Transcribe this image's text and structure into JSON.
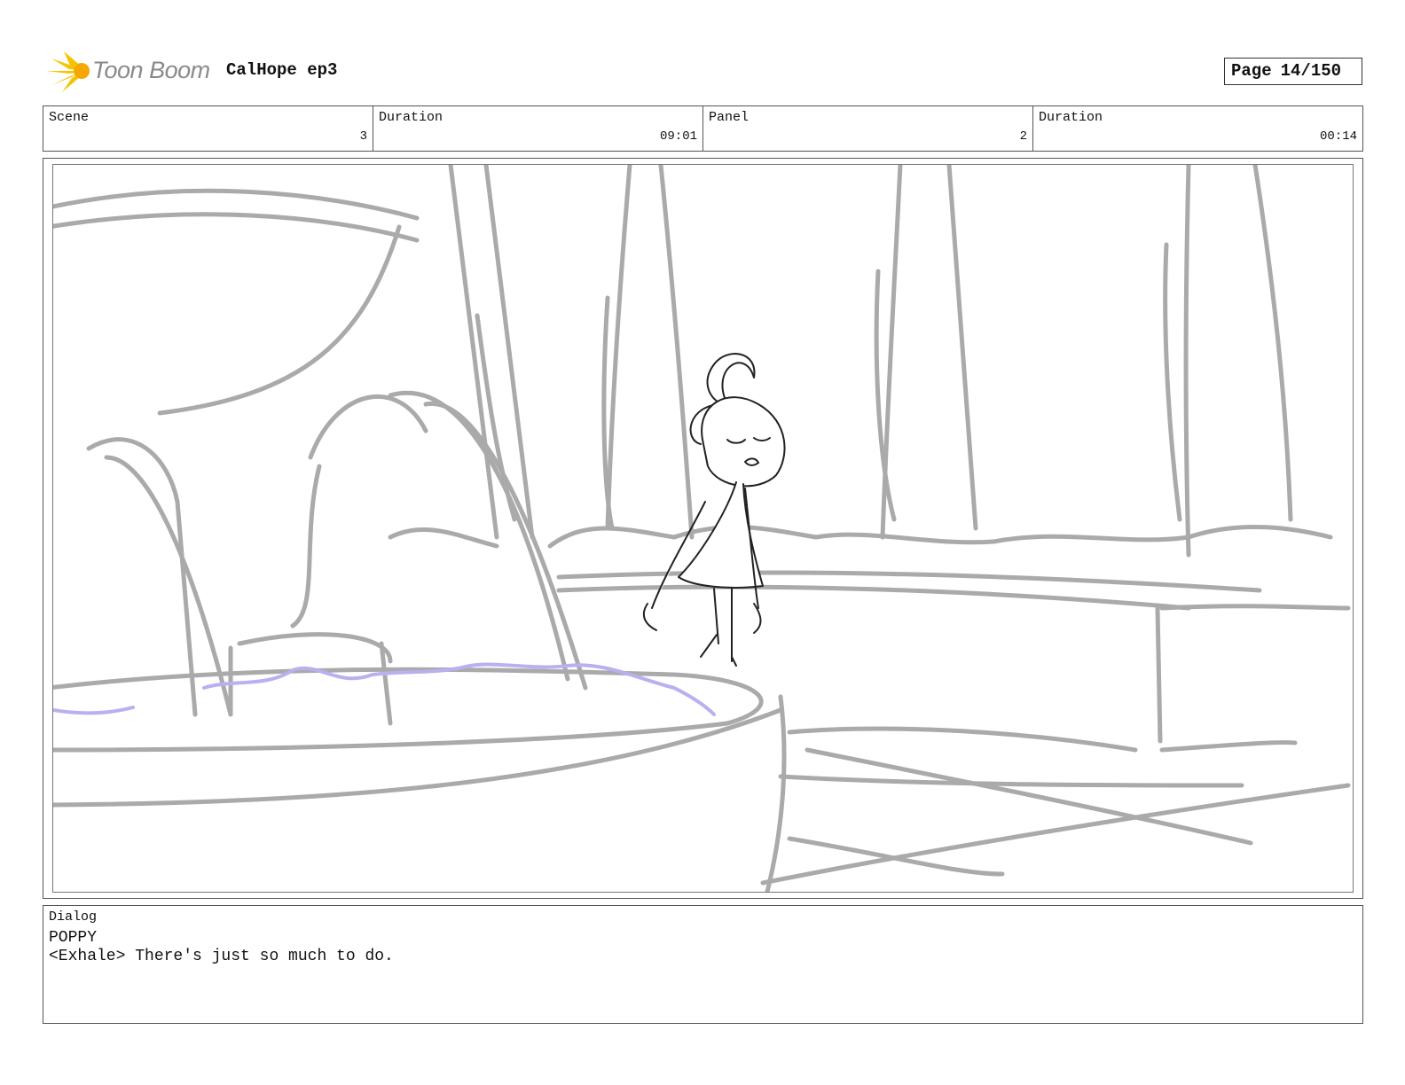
{
  "header": {
    "logo_text": "Toon Boom",
    "logo_icon": "starburst-icon",
    "project_title": "CalHope ep3",
    "page_label": "Page",
    "page_number": "14/150"
  },
  "info": {
    "scene_label": "Scene",
    "scene_value": "3",
    "scene_duration_label": "Duration",
    "scene_duration_value": "09:01",
    "panel_label": "Panel",
    "panel_value": "2",
    "panel_duration_label": "Duration",
    "panel_duration_value": "00:14"
  },
  "dialog": {
    "label": "Dialog",
    "speaker": "POPPY",
    "line": "<Exhale> There's just so much to do."
  },
  "colors": {
    "sketch_gray": "#aaaaaa",
    "water_lilac": "#b8b0f0",
    "logo_yellow": "#f5c400"
  }
}
